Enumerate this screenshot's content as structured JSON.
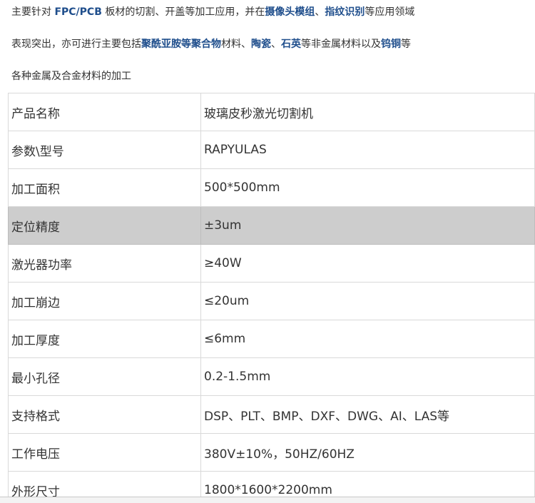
{
  "intro": {
    "line1": [
      {
        "text": "主要针对 ",
        "hl": false
      },
      {
        "text": "FPC/PCB",
        "hl": true
      },
      {
        "text": " 板材的切割、开盖等加工应用，并在",
        "hl": false
      },
      {
        "text": "摄像头模组",
        "hl": true
      },
      {
        "text": "、",
        "hl": false
      },
      {
        "text": "指纹识别",
        "hl": true
      },
      {
        "text": "等应用领域",
        "hl": false
      }
    ],
    "line2": [
      {
        "text": "表现突出，亦可进行主要包括",
        "hl": false
      },
      {
        "text": "聚酰亚胺等聚合物",
        "hl": true
      },
      {
        "text": "材料、",
        "hl": false
      },
      {
        "text": "陶瓷",
        "hl": true
      },
      {
        "text": "、",
        "hl": false
      },
      {
        "text": "石英",
        "hl": true
      },
      {
        "text": "等非金属材料以及",
        "hl": false
      },
      {
        "text": "钨铜",
        "hl": true
      },
      {
        "text": "等",
        "hl": false
      }
    ],
    "line3": [
      {
        "text": "各种金属及合金材料的加工",
        "hl": false
      }
    ],
    "highlight_color": "#1f4e8c"
  },
  "specs": [
    {
      "label": "产品名称",
      "value": "玻璃皮秒激光切割机"
    },
    {
      "label": "参数\\型号",
      "value": "RAPYULAS"
    },
    {
      "label": "加工面积",
      "value": "500*500mm"
    },
    {
      "label": "定位精度",
      "value": "±3um",
      "selected": true
    },
    {
      "label": "激光器功率",
      "value": "≥40W"
    },
    {
      "label": "加工崩边",
      "value": "≤20um"
    },
    {
      "label": "加工厚度",
      "value": "≤6mm"
    },
    {
      "label": "最小孔径",
      "value": "0.2-1.5mm"
    },
    {
      "label": "支持格式",
      "value": "DSP、PLT、BMP、DXF、DWG、AI、LAS等"
    },
    {
      "label": "工作电压",
      "value": "380V±10%，50HZ/60HZ"
    },
    {
      "label": "外形尺寸",
      "value": "1800*1600*2200mm"
    }
  ],
  "selected_row_color": "#cdcdcd"
}
